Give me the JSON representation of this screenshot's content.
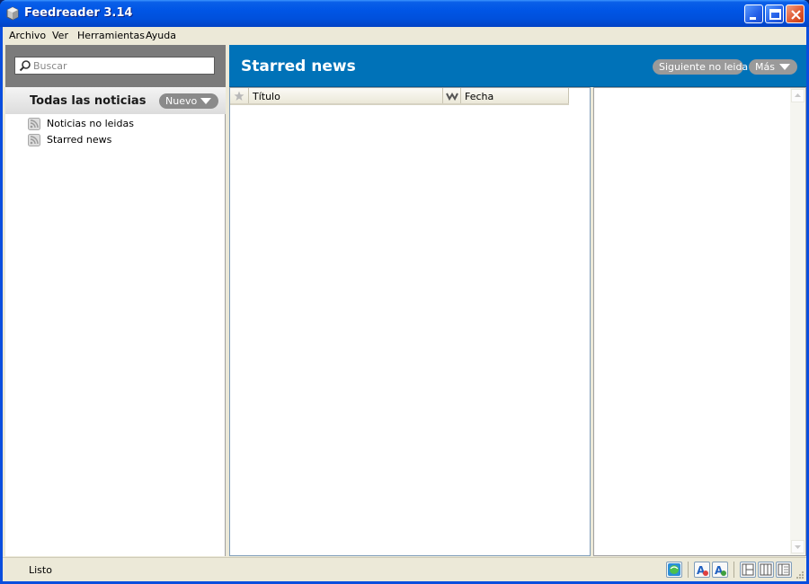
{
  "window": {
    "title": "Feedreader 3.14"
  },
  "menu": {
    "items": [
      "Archivo",
      "Ver",
      "Herramientas",
      "Ayuda"
    ]
  },
  "sidebar": {
    "search_placeholder": "Buscar",
    "header_title": "Todas las noticias",
    "new_button": "Nuevo",
    "feeds": [
      {
        "label": "Noticias no leidas",
        "icon": "rss-feed-icon"
      },
      {
        "label": "Starred news",
        "icon": "rss-feed-icon"
      }
    ]
  },
  "main": {
    "feed_title": "Starred news",
    "next_unread_button": "Siguiente no leida",
    "more_button": "Más",
    "columns": {
      "title": "Título",
      "date": "Fecha"
    }
  },
  "status": {
    "text": "Listo"
  },
  "colors": {
    "header_blue": "#0072b8",
    "titlebar_blue": "#0055e5",
    "pill_gray": "#9a9a9a"
  }
}
